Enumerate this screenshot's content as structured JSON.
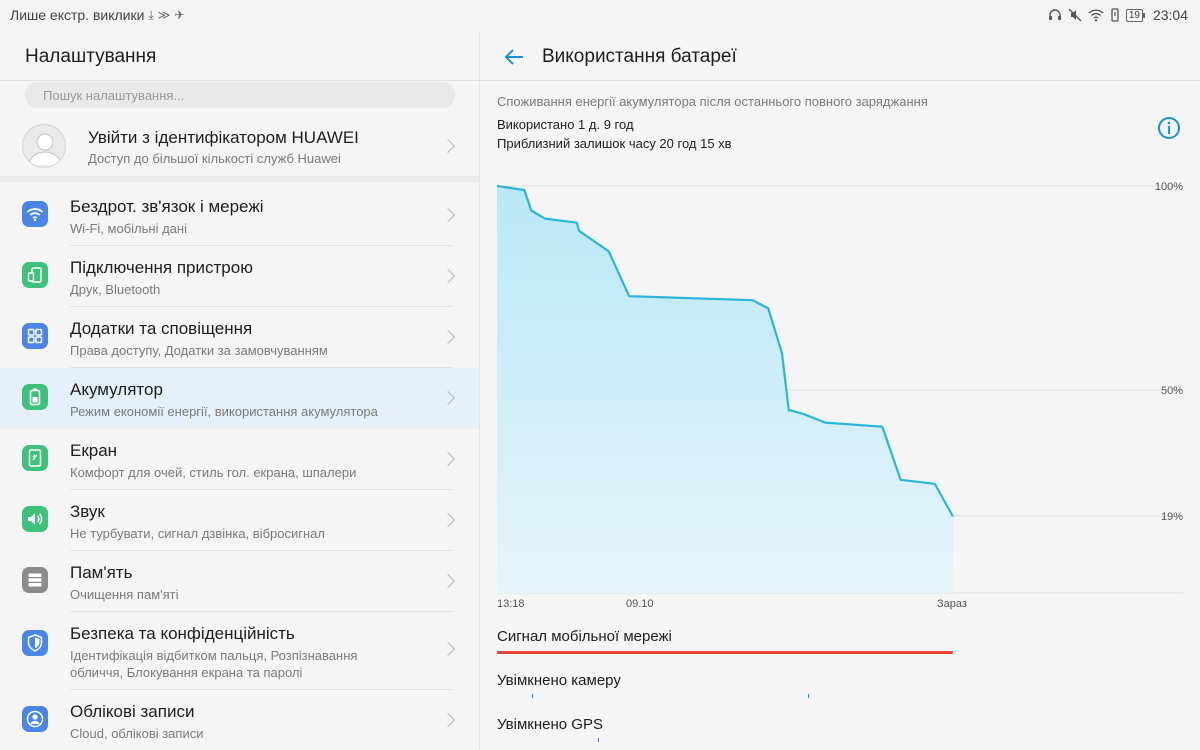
{
  "status_bar": {
    "left_text": "Лише екстр. виклики",
    "left_icons": [
      "download-icon",
      "fast-charge-icon",
      "nfc-icon"
    ],
    "right_icons": [
      "headphones-icon",
      "mute-icon",
      "wifi-icon",
      "vibrate-icon"
    ],
    "battery_level": "19",
    "time": "23:04"
  },
  "left": {
    "title": "Налаштування",
    "search_placeholder": "Пошук налаштування...",
    "account": {
      "title": "Увійти з ідентифікатором HUAWEI",
      "subtitle": "Доступ до більшої кількості служб Huawei"
    },
    "items": [
      {
        "icon": "wifi-icon",
        "title": "Бездрот. зв'язок і мережі",
        "subtitle": "Wi-Fi, мобільні дані"
      },
      {
        "icon": "device-connect-icon",
        "title": "Підключення пристрою",
        "subtitle": "Друк, Bluetooth"
      },
      {
        "icon": "apps-icon",
        "title": "Додатки та сповіщення",
        "subtitle": "Права доступу, Додатки за замовчуванням"
      },
      {
        "icon": "battery-icon",
        "title": "Акумулятор",
        "subtitle": "Режим економії енергії, використання акумулятора",
        "active": true
      },
      {
        "icon": "display-icon",
        "title": "Екран",
        "subtitle": "Комфорт для очей, стиль гол. екрана, шпалери"
      },
      {
        "icon": "sound-icon",
        "title": "Звук",
        "subtitle": "Не турбувати, сигнал дзвінка, вібросигнал"
      },
      {
        "icon": "storage-icon",
        "title": "Пам'ять",
        "subtitle": "Очищення пам'яті"
      },
      {
        "icon": "security-icon",
        "title": "Безпека та конфіденційність",
        "subtitle": "Ідентифікація відбитком пальця, Розпізнавання обличчя, Блокування екрана та паролі"
      },
      {
        "icon": "accounts-icon",
        "title": "Облікові записи",
        "subtitle": "Cloud, облікові записи"
      }
    ],
    "colors": {
      "wifi-icon": "#4a86e8",
      "device-connect-icon": "#3ec27b",
      "apps-icon": "#4a86e8",
      "battery-icon": "#3ec27b",
      "display-icon": "#3ec27b",
      "sound-icon": "#3ec27b",
      "storage-icon": "#8c8c8c",
      "security-icon": "#4a86e8",
      "accounts-icon": "#4a86e8"
    }
  },
  "right": {
    "title": "Використання батареї",
    "caption": "Споживання енергії акумулятора після останнього повного заряджання",
    "used": "Використано 1 д. 9 год",
    "remaining": "Приблизний залишок часу 20 год 15 хв",
    "accent_color": "#1b8fe0",
    "chart": {
      "y_labels": [
        "100%",
        "50%",
        "19%"
      ],
      "x_labels": [
        "13:18",
        "09.10",
        "Зараз"
      ],
      "line_color": "#29b6d8",
      "fill_color": "#c7ecf8"
    },
    "sections": [
      {
        "title": "Сигнал мобільної мережі",
        "bar_color": "#e8463a"
      },
      {
        "title": "Увімкнено камеру"
      },
      {
        "title": "Увімкнено GPS"
      }
    ]
  },
  "chart_data": {
    "type": "area",
    "y_ticks": [
      "100%",
      "50%",
      "19%"
    ],
    "x_ticks": [
      "13:18",
      "09.10",
      "Зараз"
    ],
    "ylim": [
      0,
      100
    ],
    "series": [
      {
        "values": [
          {
            "t": 0.0,
            "y": 100
          },
          {
            "t": 0.06,
            "y": 99
          },
          {
            "t": 0.075,
            "y": 94
          },
          {
            "t": 0.105,
            "y": 92
          },
          {
            "t": 0.175,
            "y": 91
          },
          {
            "t": 0.18,
            "y": 89
          },
          {
            "t": 0.245,
            "y": 84
          },
          {
            "t": 0.29,
            "y": 73
          },
          {
            "t": 0.56,
            "y": 72
          },
          {
            "t": 0.595,
            "y": 70
          },
          {
            "t": 0.625,
            "y": 59
          },
          {
            "t": 0.64,
            "y": 45
          },
          {
            "t": 0.645,
            "y": 45
          },
          {
            "t": 0.675,
            "y": 44
          },
          {
            "t": 0.72,
            "y": 42
          },
          {
            "t": 0.845,
            "y": 41
          },
          {
            "t": 0.885,
            "y": 28
          },
          {
            "t": 0.96,
            "y": 27
          },
          {
            "t": 1.0,
            "y": 19
          }
        ]
      }
    ]
  }
}
